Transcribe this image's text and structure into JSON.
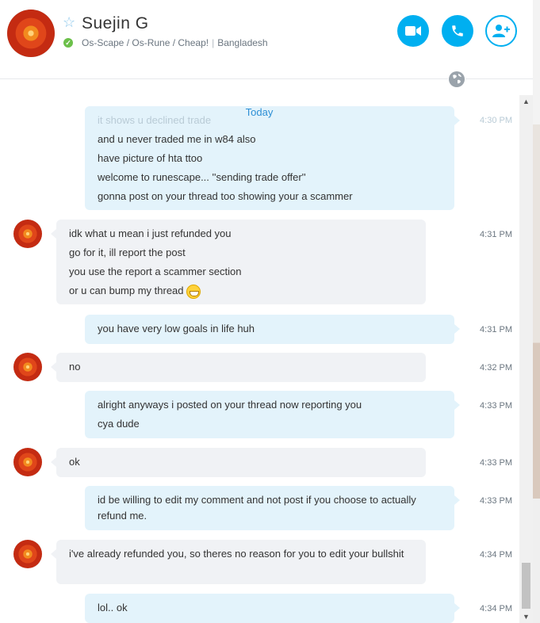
{
  "contact": {
    "name": "Suejin G",
    "mood": "Os-Scape / Os-Rune / Cheap!",
    "location": "Bangladesh"
  },
  "date_separator": "Today",
  "messages": [
    {
      "from": "me",
      "lines": [
        "it shows u declined trade",
        "and u never traded me in w84 also",
        "have picture of hta ttoo",
        "welcome to runescape... ''sending trade offer''",
        "gonna post on your thread too showing your a scammer"
      ],
      "time": "4:30 PM"
    },
    {
      "from": "contact",
      "lines": [
        "idk what u mean i just refunded you",
        "go for it, ill report the post",
        "you use the report a scammer section",
        "or u can bump my thread"
      ],
      "emoji": "grin-emoji",
      "time": "4:31 PM"
    },
    {
      "from": "me",
      "lines": [
        "you have very low goals in life huh"
      ],
      "time": "4:31 PM"
    },
    {
      "from": "contact",
      "lines": [
        "no"
      ],
      "time": "4:32 PM"
    },
    {
      "from": "me",
      "lines": [
        "alright anyways i posted on your thread now reporting you",
        "cya dude"
      ],
      "time": "4:33 PM"
    },
    {
      "from": "contact",
      "lines": [
        "ok"
      ],
      "time": "4:33 PM"
    },
    {
      "from": "me",
      "lines": [
        "id be willing to edit my comment and not post if you choose to actually refund me."
      ],
      "time": "4:33 PM"
    },
    {
      "from": "contact",
      "lines": [
        "i've already refunded you, so theres no reason for you to edit your bullshit"
      ],
      "time": "4:34 PM"
    },
    {
      "from": "me",
      "lines": [
        "lol.. ok"
      ],
      "time": "4:34 PM"
    }
  ],
  "colors": {
    "accent": "#00aff0",
    "online": "#6cc04a",
    "outgoing_bubble": "#e3f3fb",
    "incoming_bubble": "#f0f2f5",
    "today_text": "#2d8fd5"
  }
}
